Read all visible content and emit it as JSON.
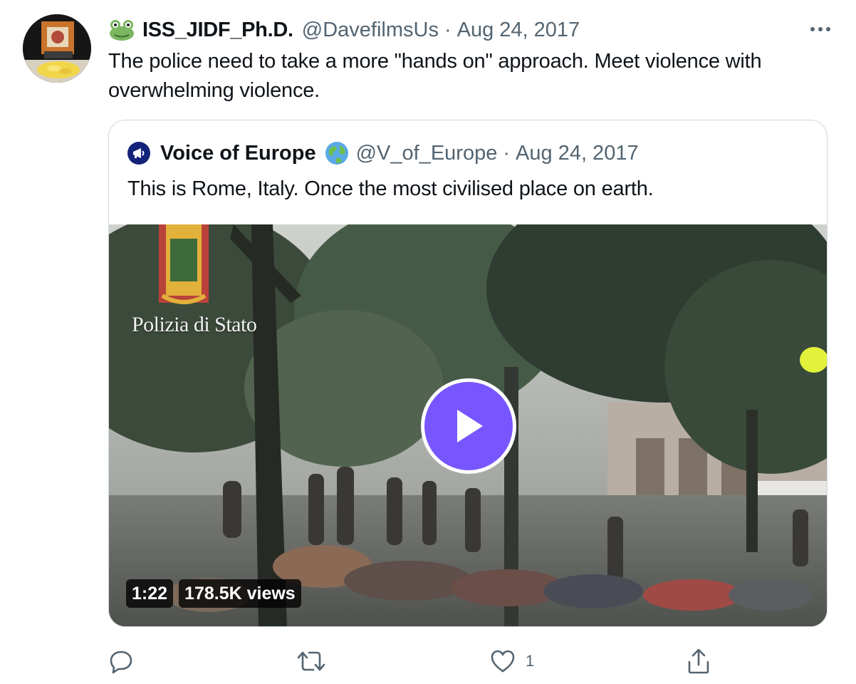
{
  "tweet": {
    "author_name": "ISS_JIDF_Ph.D.",
    "author_handle": "@DavefilmsUs",
    "separator": "·",
    "date": "Aug 24, 2017",
    "text": "The police need to take a more \"hands on\" approach. Meet violence with overwhelming violence.",
    "more_icon": "more-icon",
    "name_emoji_icon": "frog-icon"
  },
  "quoted": {
    "author_name": "Voice of Europe",
    "author_handle": "@V_of_Europe",
    "separator": "·",
    "date": "Aug 24, 2017",
    "text": "This is Rome, Italy. Once the most civilised place on earth.",
    "name_emoji_icon": "globe-icon",
    "video": {
      "watermark": "Polizia di Stato",
      "duration": "1:22",
      "views": "178.5K views",
      "play_color": "#7856ff"
    }
  },
  "actions": {
    "reply_icon": "reply-icon",
    "retweet_icon": "retweet-icon",
    "like_icon": "like-icon",
    "like_count": "1",
    "share_icon": "share-icon"
  }
}
